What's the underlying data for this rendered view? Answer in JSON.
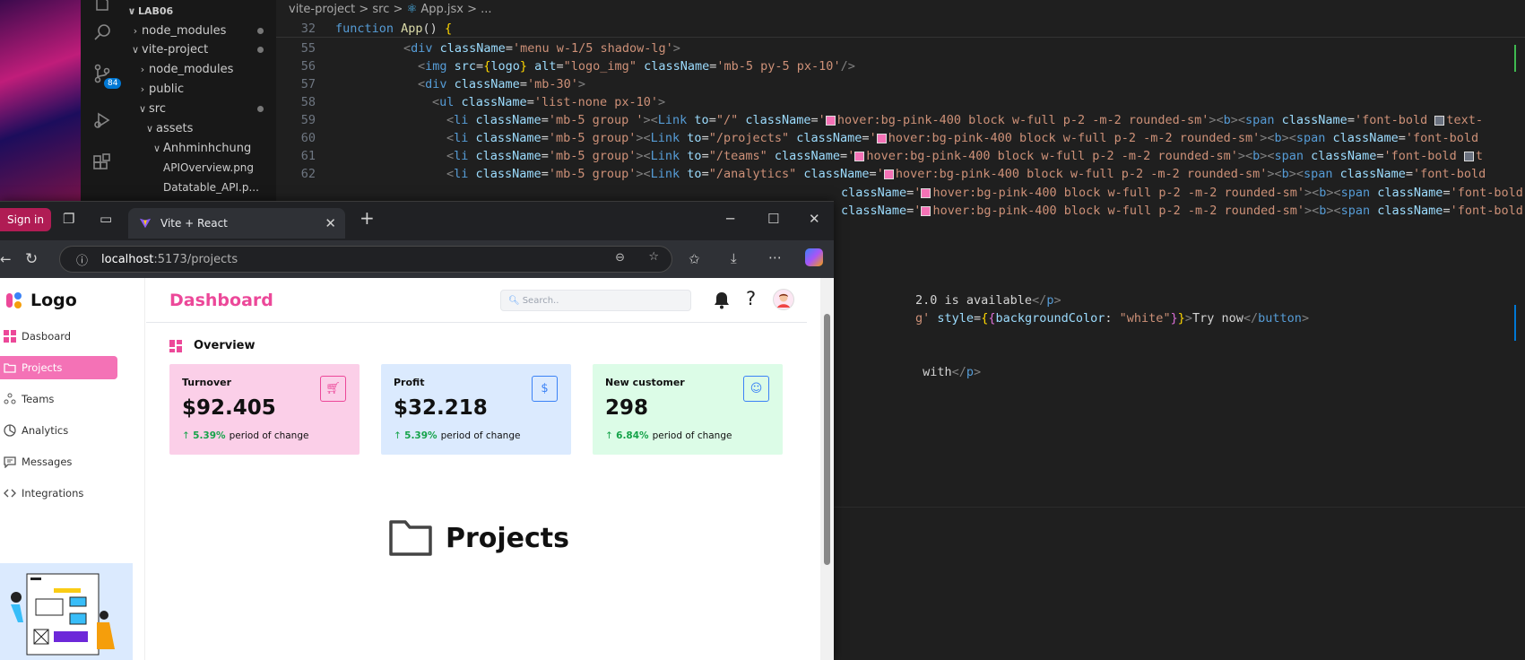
{
  "vscode": {
    "badge_count": "84",
    "explorer": {
      "items": [
        {
          "label": "LAB06",
          "chev": "∨",
          "indent": 0
        },
        {
          "label": "node_modules",
          "chev": "›",
          "indent": 1
        },
        {
          "label": "vite-project",
          "chev": "∨",
          "indent": 1
        },
        {
          "label": "node_modules",
          "chev": "›",
          "indent": 2
        },
        {
          "label": "public",
          "chev": "›",
          "indent": 2
        },
        {
          "label": "src",
          "chev": "∨",
          "indent": 2
        },
        {
          "label": "assets",
          "chev": "∨",
          "indent": 3
        },
        {
          "label": "Anhminhchung",
          "chev": "∨",
          "indent": 4
        },
        {
          "label": "APIOverview.png",
          "chev": "",
          "indent": 5
        },
        {
          "label": "Datatable_API.p...",
          "chev": "",
          "indent": 5
        }
      ]
    },
    "breadcrumb": {
      "p1": "vite-project",
      "sep": ">",
      "p2": "src",
      "p3": "App.jsx",
      "p4": "..."
    },
    "sticky_line": {
      "num": "32",
      "text": "function App() {"
    },
    "line_numbers": [
      "55",
      "56",
      "57",
      "58",
      "59",
      "60",
      "61",
      "62"
    ],
    "code": {
      "l55": "menu w-1/5 shadow-lg",
      "l56_alt": "logo_img",
      "l56_cls": "mb-5 py-5 px-10",
      "l57": "mb-30",
      "l58": "list-none px-10",
      "li_cls": "mb-5 group",
      "li_cls_first": "mb-5 group ",
      "link_cls": "hover:bg-pink-400 block w-full p-2 -m-2 rounded-sm",
      "to1": "/",
      "to2": "/projects",
      "to3": "/teams",
      "to4": "/analytics",
      "span_cls_a": "font-bold ",
      "span_cls_b": "font-bold",
      "text_tail": "text-",
      "t_tail": "t",
      "right1_a": "2.0 is available",
      "right2_a": "g'",
      "right2_b": "style",
      "right2_c": "backgroundColor",
      "right2_d": "white",
      "right2_e": "Try now",
      "right3_a": " with"
    }
  },
  "browser": {
    "signin": "Sign in",
    "tab_title": "Vite + React",
    "url_host": "localhost",
    "url_path": ":5173/projects",
    "app": {
      "logo_text": "Logo",
      "nav": [
        {
          "label": "Dasboard",
          "icon": "grid-icon"
        },
        {
          "label": "Projects",
          "icon": "folder-icon"
        },
        {
          "label": "Teams",
          "icon": "team-icon"
        },
        {
          "label": "Analytics",
          "icon": "pie-chart-icon"
        },
        {
          "label": "Messages",
          "icon": "message-icon"
        },
        {
          "label": "Integrations",
          "icon": "code-icon"
        }
      ],
      "header_title": "Dashboard",
      "search_placeholder": "Search..",
      "overview_title": "Overview",
      "cards": [
        {
          "label": "Turnover",
          "value": "$92.405",
          "change": "5.39%",
          "change_text": "period of change",
          "bg": "#fbcfe8",
          "accent": "#ec4899",
          "icon": "cart-icon"
        },
        {
          "label": "Profit",
          "value": "$32.218",
          "change": "5.39%",
          "change_text": "period of change",
          "bg": "#dbeafe",
          "accent": "#3b82f6",
          "icon": "dollar-icon"
        },
        {
          "label": "New customer",
          "value": "298",
          "change": "6.84%",
          "change_text": "period of change",
          "bg": "#dcfce7",
          "accent": "#3b82f6",
          "icon": "user-circle-icon"
        }
      ],
      "page_heading": "Projects"
    }
  }
}
